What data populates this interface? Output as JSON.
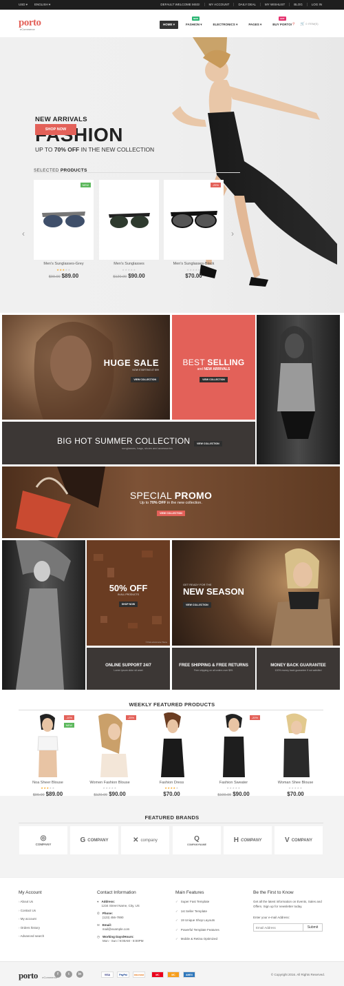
{
  "topbar": {
    "currency": "USD",
    "language": "ENGLISH",
    "links": [
      "DEFAULT WELCOME MSG!",
      "MY ACCOUNT",
      "DAILY DEAL",
      "MY WISHLIST",
      "BLOG",
      "LOG IN"
    ]
  },
  "header": {
    "logo": "porto",
    "logo_sub": "eCommerce",
    "nav": [
      {
        "label": "HOME"
      },
      {
        "label": "FASHION",
        "badge": "NEW",
        "badge_color": "#2bb673"
      },
      {
        "label": "ELECTRONICS"
      },
      {
        "label": "PAGES"
      },
      {
        "label": "BUY PORTO!",
        "badge": "HOT",
        "badge_color": "#e5336f"
      }
    ],
    "cart": "0 ITEM(S)"
  },
  "hero": {
    "kicker": "NEW ARRIVALS",
    "title": "FASHION",
    "sub_pre": "UP TO ",
    "sub_bold": "70% OFF",
    "sub_post": " IN THE NEW COLLECTION",
    "button": "SHOP NOW"
  },
  "selected": {
    "title_pre": "SELECTED ",
    "title_bold": "PRODUCTS",
    "items": [
      {
        "name": "Men's Sunglasses-Grey",
        "old": "$99.00",
        "price": "$89.00",
        "tag": "NEW",
        "tag_color": "#5cb85c",
        "rating": 3
      },
      {
        "name": "Men's Sunglasses",
        "old": "$120.00",
        "price": "$90.00",
        "tag": "",
        "rating": 0
      },
      {
        "name": "Men's Sunglasses-Black",
        "old": "",
        "price": "$70.00",
        "tag": "-25%",
        "tag_color": "#e36159",
        "rating": 0
      }
    ]
  },
  "banners": {
    "huge": {
      "t1": "HUGE",
      "t2": "SALE",
      "sub": "NOW STARTING AT $99",
      "btn": "VIEW COLLECTION"
    },
    "best": {
      "t1": "BEST",
      "t2": "SELLING",
      "sub_pre": "and ",
      "sub_bold": "NEW ARRIVALS",
      "btn": "VIEW COLLECTION"
    },
    "summer": {
      "title": "BIG HOT SUMMER COLLECTION",
      "sub": "sunglasses, bags, shoes and accessories",
      "btn": "VIEW COLLECTION"
    },
    "promo": {
      "t1": "SPECIAL",
      "t2": "PROMO",
      "sub_pre": "Up to ",
      "sub_bold": "70% OFF",
      "sub_post": " in the new collection.",
      "btn": "VIEW COLLECTION"
    },
    "off": {
      "title": "50% OFF",
      "sub": "IN ALL PRODUCTS",
      "btn": "SHOP NOW",
      "credit": "© Porto eCommerce Theme"
    },
    "season": {
      "pre": "GET READY FOR THE",
      "title": "NEW SEASON",
      "btn": "VIEW COLLECTION"
    }
  },
  "features": [
    {
      "title": "ONLINE SUPPORT 24/7",
      "sub": "Lorem ipsum dolor sit amet"
    },
    {
      "title": "FREE SHIPPING & FREE RETURNS",
      "sub": "Free shipping on all orders over $99."
    },
    {
      "title": "MONEY BACK GUARANTEE",
      "sub": "100% money back guarantee if not satisfied"
    }
  ],
  "weekly": {
    "title": "WEEKLY FEATURED PRODUCTS",
    "items": [
      {
        "name": "Noa Sheer Blouse",
        "old": "$99.00",
        "price": "$89.00",
        "tags": [
          "-10%",
          "NEW"
        ],
        "rating": 3
      },
      {
        "name": "Women Fashion Blouse",
        "old": "$120.00",
        "price": "$90.00",
        "tags": [
          "-25%"
        ],
        "rating": 0
      },
      {
        "name": "Fashion Dress",
        "old": "",
        "price": "$70.00",
        "tags": [],
        "rating": 4
      },
      {
        "name": "Fashion Sweater",
        "old": "$100.00",
        "price": "$90.00",
        "tags": [
          "-20%"
        ],
        "rating": 0
      },
      {
        "name": "Woman Shee Blouse",
        "old": "",
        "price": "$70.00",
        "tags": [],
        "rating": 0
      }
    ]
  },
  "brands": {
    "title": "FEATURED BRANDS",
    "items": [
      "COMPANY",
      "COMPANY",
      "company",
      "COMPANYNAME",
      "COMPANY",
      "COMPANY"
    ]
  },
  "footer": {
    "account": {
      "title": "My Account",
      "links": [
        "About Us",
        "Contact Us",
        "My account",
        "Orders history",
        "Advanced search"
      ]
    },
    "contact": {
      "title": "Contact Information",
      "address_label": "Address:",
      "address": "1234 Street Name, City, US",
      "phone_label": "Phone:",
      "phone": "(123) 456-7890",
      "email_label": "Email:",
      "email": "mail@example.com",
      "hours_label": "Working Days/Hours:",
      "hours": "Mon - Sun / 9:00AM - 8:00PM"
    },
    "features": {
      "title": "Main Features",
      "items": [
        "Super Fast Template",
        "1st Seller Template",
        "19 Unique Shop Layouts",
        "Powerful Template Features",
        "Mobile & Retina Optimized"
      ]
    },
    "newsletter": {
      "title": "Be the First to Know",
      "text": "Get all the latest information on Events, Sales and Offers. Sign up for newsletter today.",
      "label": "Enter your e-mail Address:",
      "placeholder": "Email Address",
      "button": "Submit"
    }
  },
  "bottom": {
    "logo": "porto",
    "logo_sub": "eCommerce",
    "social": [
      "f",
      "t",
      "in"
    ],
    "payments": [
      "VISA",
      "PayPal",
      "DISCOVER",
      "MC",
      "MC",
      "AMEX"
    ],
    "copyright": "© Copyright 2016. All Rights Reserved."
  }
}
